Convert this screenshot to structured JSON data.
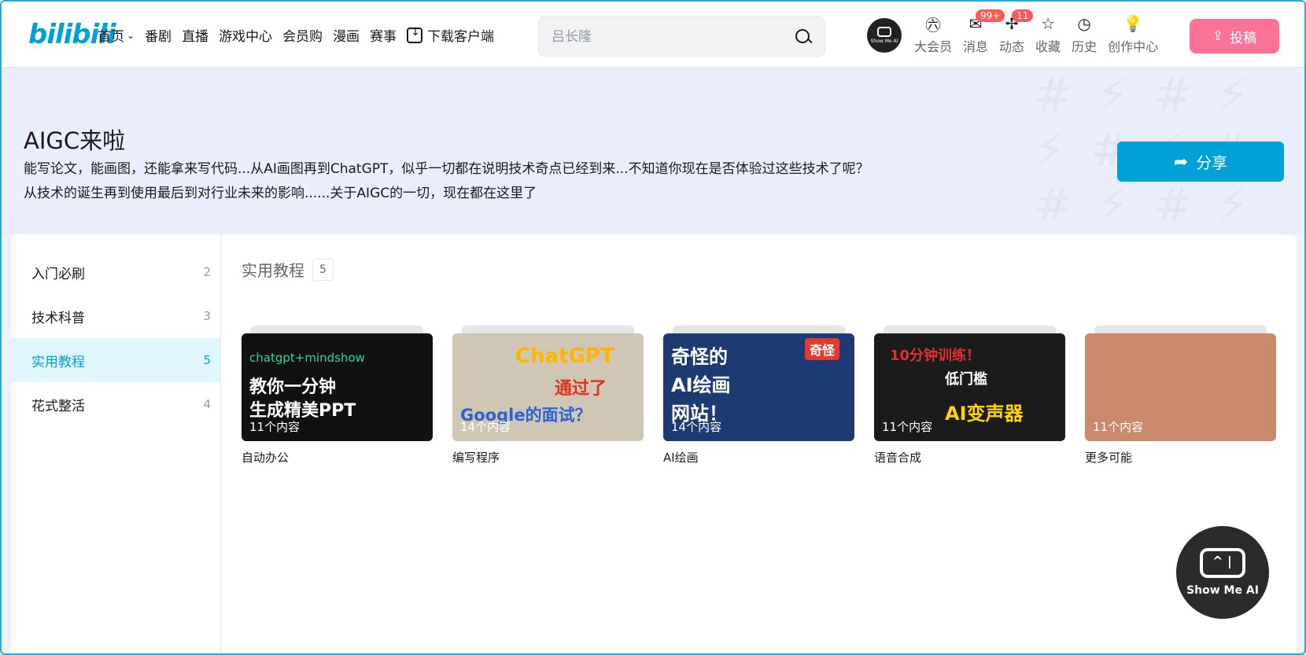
{
  "header": {
    "logo": "bilibili",
    "nav": [
      {
        "label": "首页",
        "has_dropdown": true
      },
      {
        "label": "番剧"
      },
      {
        "label": "直播"
      },
      {
        "label": "游戏中心"
      },
      {
        "label": "会员购"
      },
      {
        "label": "漫画"
      },
      {
        "label": "赛事"
      },
      {
        "label": "下载客户端",
        "icon": "download-icon"
      }
    ],
    "search_placeholder": "吕长隆",
    "avatar_label": "Show Me AI",
    "right_nav": [
      {
        "label": "大会员",
        "icon": "vip-icon",
        "badge": ""
      },
      {
        "label": "消息",
        "icon": "message-icon",
        "badge": "99+"
      },
      {
        "label": "动态",
        "icon": "dynamic-icon",
        "badge": "11"
      },
      {
        "label": "收藏",
        "icon": "star-icon",
        "badge": ""
      },
      {
        "label": "历史",
        "icon": "clock-icon",
        "badge": ""
      },
      {
        "label": "创作中心",
        "icon": "bulb-icon",
        "badge": ""
      }
    ],
    "upload_label": "投稿"
  },
  "topic": {
    "title": "AIGC来啦",
    "description": "能写论文，能画图，还能拿来写代码...从AI画图再到ChatGPT，似乎一切都在说明技术奇点已经到来...不知道你现在是否体验过这些技术了呢？从技术的诞生再到使用最后到对行业未来的影响......关于AIGC的一切，现在都在这里了",
    "share_label": "分享"
  },
  "sidebar": [
    {
      "label": "入门必刷",
      "count": "2"
    },
    {
      "label": "技术科普",
      "count": "3"
    },
    {
      "label": "实用教程",
      "count": "5",
      "active": true
    },
    {
      "label": "花式整活",
      "count": "4"
    }
  ],
  "section": {
    "title": "实用教程",
    "count": "5"
  },
  "cards": [
    {
      "label": "自动办公",
      "count": "11个内容",
      "thumb_text": [
        "chatgpt+mindshow",
        "教你一分钟",
        "生成精美PPT"
      ]
    },
    {
      "label": "编写程序",
      "count": "14个内容",
      "thumb_text": [
        "ChatGPT",
        "通过了",
        "Google的面试？"
      ]
    },
    {
      "label": "AI绘画",
      "count": "14个内容",
      "thumb_text": [
        "奇怪的",
        "AI绘画",
        "网站！",
        "奇怪"
      ]
    },
    {
      "label": "语音合成",
      "count": "11个内容",
      "thumb_text": [
        "10分钟训练！",
        "低门槛",
        "AI变声器"
      ]
    },
    {
      "label": "更多可能",
      "count": "11个内容",
      "thumb_text": []
    }
  ],
  "float_button": {
    "label": "Show Me AI"
  },
  "colors": {
    "brand": "#00a1d6",
    "upload": "#fb7299",
    "badge": "#fa5a57"
  }
}
